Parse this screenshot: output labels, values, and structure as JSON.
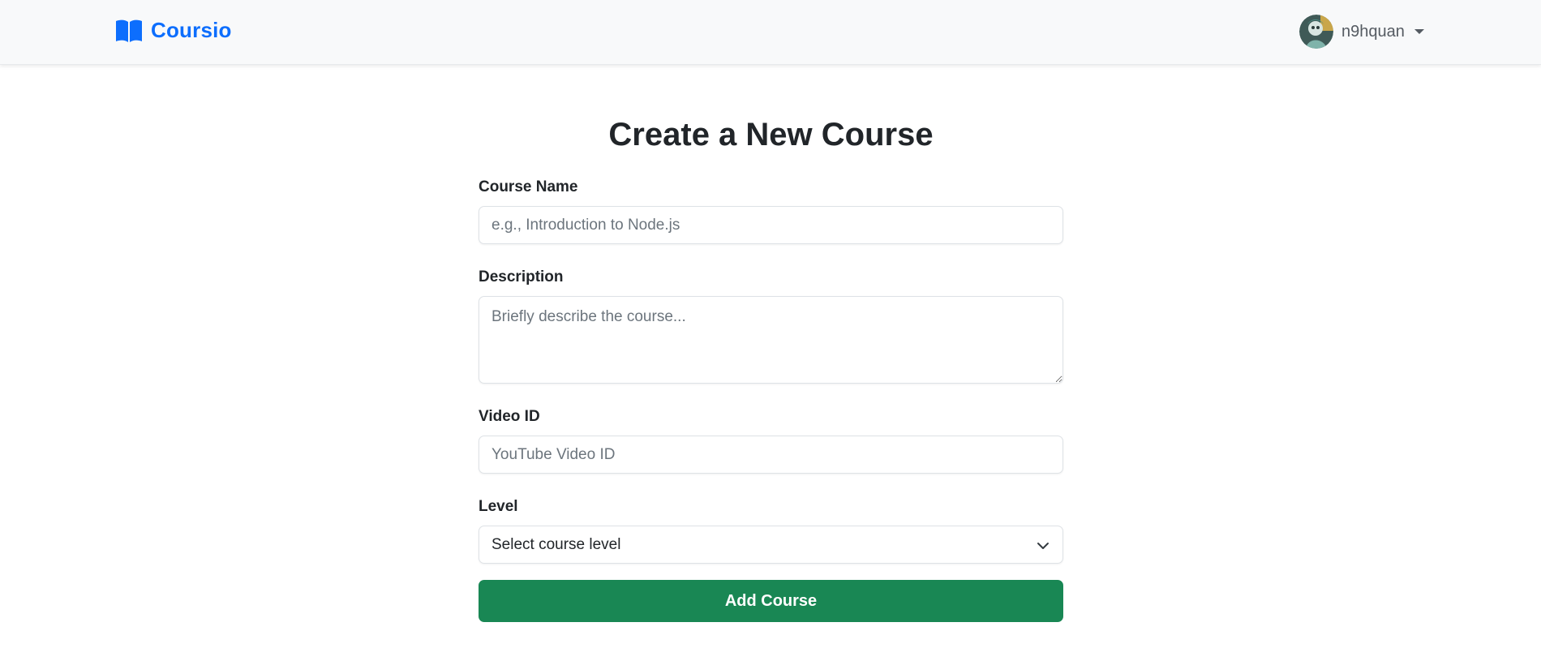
{
  "brand": {
    "name": "Coursio",
    "icon": "book-icon",
    "color": "#0d6efd"
  },
  "user": {
    "username": "n9hquan",
    "avatar": "avatar-image",
    "menu_icon": "caret-down-icon"
  },
  "page": {
    "title": "Create a New Course"
  },
  "form": {
    "course_name": {
      "label": "Course Name",
      "placeholder": "e.g., Introduction to Node.js",
      "value": ""
    },
    "description": {
      "label": "Description",
      "placeholder": "Briefly describe the course...",
      "value": ""
    },
    "video_id": {
      "label": "Video ID",
      "placeholder": "YouTube Video ID",
      "value": ""
    },
    "level": {
      "label": "Level",
      "selected": "Select course level",
      "icon": "chevron-down-icon"
    },
    "submit_label": "Add Course",
    "submit_color": "#198754"
  }
}
